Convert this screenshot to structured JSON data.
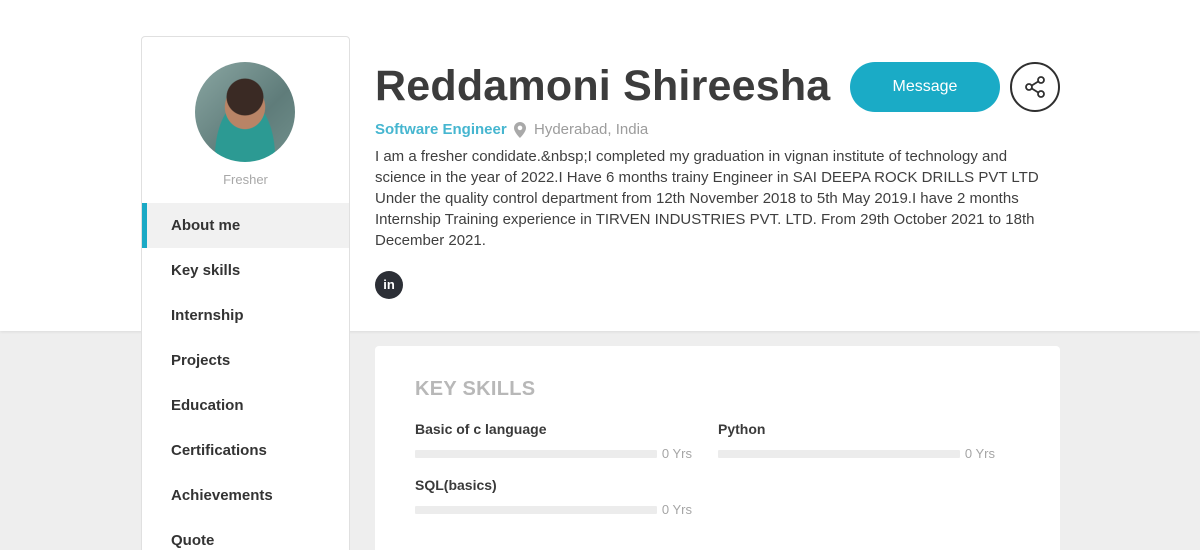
{
  "profile": {
    "name": "Reddamoni Shireesha",
    "role": "Software Engineer",
    "location": "Hyderabad, India",
    "status": "Fresher",
    "bio": "I am a fresher condidate.&nbsp;I completed my graduation in vignan institute of technology and science in the year of 2022.I Have 6 months trainy Engineer in SAI DEEPA ROCK DRILLS PVT LTD Under the quality control department from 12th November 2018 to 5th May 2019.I have 2 months Internship Training experience in TIRVEN INDUSTRIES PVT. LTD. From 29th October 2021 to 18th December 2021.",
    "linkedin_label": "in"
  },
  "actions": {
    "message_label": "Message",
    "share_icon": "share-icon"
  },
  "sidebar": {
    "items": [
      {
        "label": "About me",
        "active": true
      },
      {
        "label": "Key skills"
      },
      {
        "label": "Internship"
      },
      {
        "label": "Projects"
      },
      {
        "label": "Education"
      },
      {
        "label": "Certifications"
      },
      {
        "label": "Achievements"
      },
      {
        "label": "Quote"
      }
    ]
  },
  "skills": {
    "title": "KEY SKILLS",
    "items": [
      {
        "name": "Basic of c language",
        "years": "0 Yrs",
        "level": 0
      },
      {
        "name": "Python",
        "years": "0 Yrs",
        "level": 0
      },
      {
        "name": "SQL(basics)",
        "years": "0 Yrs",
        "level": 0
      }
    ]
  },
  "colors": {
    "accent": "#1aabc6",
    "role_text": "#46b6d0",
    "page_background": "#eeeeee"
  }
}
